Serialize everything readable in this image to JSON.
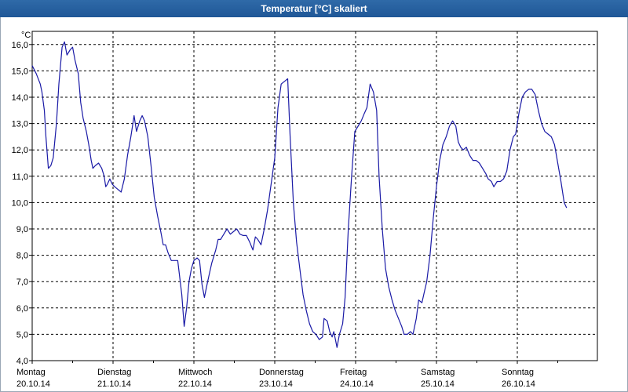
{
  "window": {
    "title": "Temperatur [°C] skaliert"
  },
  "chart_data": {
    "type": "line",
    "title": "Temperatur [°C] skaliert",
    "unit_label": "°C",
    "ylim": [
      4.0,
      16.5
    ],
    "xlim": [
      0,
      7
    ],
    "grid": true,
    "y_ticks": [
      "4,0",
      "5,0",
      "6,0",
      "7,0",
      "8,0",
      "9,0",
      "10,0",
      "11,0",
      "12,0",
      "13,0",
      "14,0",
      "15,0",
      "16,0"
    ],
    "y_tick_values": [
      4,
      5,
      6,
      7,
      8,
      9,
      10,
      11,
      12,
      13,
      14,
      15,
      16
    ],
    "x_ticks": [
      {
        "day": "Montag",
        "date": "20.10.14"
      },
      {
        "day": "Dienstag",
        "date": "21.10.14"
      },
      {
        "day": "Mittwoch",
        "date": "22.10.14"
      },
      {
        "day": "Donnerstag",
        "date": "23.10.14"
      },
      {
        "day": "Freitag",
        "date": "24.10.14"
      },
      {
        "day": "Samstag",
        "date": "25.10.14"
      },
      {
        "day": "Sonntag",
        "date": "26.10.14"
      }
    ],
    "series": [
      {
        "color": "#1a1aa6",
        "points": [
          [
            0.0,
            15.2
          ],
          [
            0.05,
            14.9
          ],
          [
            0.1,
            14.5
          ],
          [
            0.12,
            14.2
          ],
          [
            0.15,
            13.5
          ],
          [
            0.17,
            12.5
          ],
          [
            0.2,
            11.3
          ],
          [
            0.23,
            11.4
          ],
          [
            0.26,
            11.7
          ],
          [
            0.3,
            13.0
          ],
          [
            0.33,
            14.5
          ],
          [
            0.37,
            15.9
          ],
          [
            0.4,
            16.1
          ],
          [
            0.43,
            15.6
          ],
          [
            0.47,
            15.8
          ],
          [
            0.5,
            15.9
          ],
          [
            0.53,
            15.4
          ],
          [
            0.57,
            14.9
          ],
          [
            0.6,
            13.8
          ],
          [
            0.63,
            13.2
          ],
          [
            0.67,
            12.7
          ],
          [
            0.7,
            12.2
          ],
          [
            0.73,
            11.6
          ],
          [
            0.75,
            11.3
          ],
          [
            0.78,
            11.4
          ],
          [
            0.82,
            11.5
          ],
          [
            0.86,
            11.3
          ],
          [
            0.89,
            11.0
          ],
          [
            0.91,
            10.6
          ],
          [
            0.93,
            10.7
          ],
          [
            0.96,
            10.9
          ],
          [
            0.99,
            10.7
          ],
          [
            1.02,
            10.6
          ],
          [
            1.06,
            10.5
          ],
          [
            1.1,
            10.4
          ],
          [
            1.14,
            10.9
          ],
          [
            1.18,
            11.8
          ],
          [
            1.22,
            12.5
          ],
          [
            1.26,
            13.3
          ],
          [
            1.29,
            12.7
          ],
          [
            1.33,
            13.1
          ],
          [
            1.36,
            13.3
          ],
          [
            1.39,
            13.1
          ],
          [
            1.43,
            12.5
          ],
          [
            1.47,
            11.4
          ],
          [
            1.51,
            10.2
          ],
          [
            1.55,
            9.5
          ],
          [
            1.59,
            8.9
          ],
          [
            1.62,
            8.4
          ],
          [
            1.65,
            8.4
          ],
          [
            1.68,
            8.1
          ],
          [
            1.72,
            7.8
          ],
          [
            1.75,
            7.8
          ],
          [
            1.8,
            7.8
          ],
          [
            1.85,
            6.5
          ],
          [
            1.88,
            5.3
          ],
          [
            1.91,
            6.0
          ],
          [
            1.94,
            7.0
          ],
          [
            1.97,
            7.5
          ],
          [
            2.0,
            7.8
          ],
          [
            2.04,
            7.9
          ],
          [
            2.07,
            7.8
          ],
          [
            2.1,
            6.9
          ],
          [
            2.13,
            6.4
          ],
          [
            2.17,
            7.0
          ],
          [
            2.22,
            7.7
          ],
          [
            2.27,
            8.2
          ],
          [
            2.3,
            8.6
          ],
          [
            2.33,
            8.6
          ],
          [
            2.37,
            8.8
          ],
          [
            2.41,
            9.0
          ],
          [
            2.45,
            8.8
          ],
          [
            2.49,
            8.9
          ],
          [
            2.53,
            9.0
          ],
          [
            2.57,
            8.8
          ],
          [
            2.61,
            8.75
          ],
          [
            2.65,
            8.75
          ],
          [
            2.69,
            8.5
          ],
          [
            2.73,
            8.2
          ],
          [
            2.76,
            8.7
          ],
          [
            2.79,
            8.6
          ],
          [
            2.83,
            8.4
          ],
          [
            2.87,
            9.0
          ],
          [
            2.91,
            9.7
          ],
          [
            2.95,
            10.6
          ],
          [
            3.0,
            11.7
          ],
          [
            3.04,
            13.6
          ],
          [
            3.08,
            14.5
          ],
          [
            3.12,
            14.6
          ],
          [
            3.16,
            14.7
          ],
          [
            3.19,
            12.5
          ],
          [
            3.23,
            10.0
          ],
          [
            3.27,
            8.5
          ],
          [
            3.31,
            7.5
          ],
          [
            3.35,
            6.5
          ],
          [
            3.39,
            5.9
          ],
          [
            3.43,
            5.4
          ],
          [
            3.47,
            5.1
          ],
          [
            3.51,
            5.0
          ],
          [
            3.55,
            4.8
          ],
          [
            3.59,
            4.9
          ],
          [
            3.61,
            5.6
          ],
          [
            3.65,
            5.5
          ],
          [
            3.68,
            5.1
          ],
          [
            3.71,
            4.9
          ],
          [
            3.73,
            5.1
          ],
          [
            3.75,
            4.8
          ],
          [
            3.77,
            4.5
          ],
          [
            3.8,
            5.0
          ],
          [
            3.84,
            5.4
          ],
          [
            3.87,
            6.4
          ],
          [
            3.91,
            9.0
          ],
          [
            3.95,
            11.0
          ],
          [
            3.99,
            12.7
          ],
          [
            4.03,
            12.9
          ],
          [
            4.07,
            13.1
          ],
          [
            4.11,
            13.4
          ],
          [
            4.14,
            13.6
          ],
          [
            4.18,
            14.5
          ],
          [
            4.22,
            14.2
          ],
          [
            4.26,
            13.5
          ],
          [
            4.29,
            11.0
          ],
          [
            4.33,
            9.0
          ],
          [
            4.37,
            7.5
          ],
          [
            4.41,
            6.8
          ],
          [
            4.45,
            6.3
          ],
          [
            4.49,
            5.9
          ],
          [
            4.53,
            5.6
          ],
          [
            4.57,
            5.3
          ],
          [
            4.6,
            5.0
          ],
          [
            4.64,
            5.0
          ],
          [
            4.68,
            5.1
          ],
          [
            4.71,
            5.0
          ],
          [
            4.75,
            5.6
          ],
          [
            4.78,
            6.3
          ],
          [
            4.82,
            6.2
          ],
          [
            4.85,
            6.6
          ],
          [
            4.88,
            7.0
          ],
          [
            4.92,
            8.0
          ],
          [
            4.96,
            9.4
          ],
          [
            5.0,
            10.6
          ],
          [
            5.04,
            11.6
          ],
          [
            5.08,
            12.2
          ],
          [
            5.12,
            12.5
          ],
          [
            5.16,
            12.9
          ],
          [
            5.2,
            13.1
          ],
          [
            5.24,
            12.9
          ],
          [
            5.27,
            12.3
          ],
          [
            5.3,
            12.1
          ],
          [
            5.33,
            12.0
          ],
          [
            5.37,
            12.1
          ],
          [
            5.41,
            11.8
          ],
          [
            5.45,
            11.6
          ],
          [
            5.49,
            11.6
          ],
          [
            5.53,
            11.5
          ],
          [
            5.57,
            11.3
          ],
          [
            5.61,
            11.1
          ],
          [
            5.64,
            10.9
          ],
          [
            5.68,
            10.8
          ],
          [
            5.71,
            10.6
          ],
          [
            5.75,
            10.8
          ],
          [
            5.79,
            10.8
          ],
          [
            5.83,
            10.9
          ],
          [
            5.87,
            11.2
          ],
          [
            5.91,
            12.0
          ],
          [
            5.95,
            12.5
          ],
          [
            5.98,
            12.6
          ],
          [
            6.02,
            13.4
          ],
          [
            6.06,
            14.0
          ],
          [
            6.1,
            14.2
          ],
          [
            6.14,
            14.3
          ],
          [
            6.18,
            14.3
          ],
          [
            6.22,
            14.1
          ],
          [
            6.26,
            13.5
          ],
          [
            6.3,
            13.0
          ],
          [
            6.34,
            12.7
          ],
          [
            6.38,
            12.6
          ],
          [
            6.42,
            12.5
          ],
          [
            6.46,
            12.2
          ],
          [
            6.5,
            11.5
          ],
          [
            6.54,
            10.8
          ],
          [
            6.58,
            10.0
          ],
          [
            6.61,
            9.8
          ]
        ]
      }
    ]
  }
}
